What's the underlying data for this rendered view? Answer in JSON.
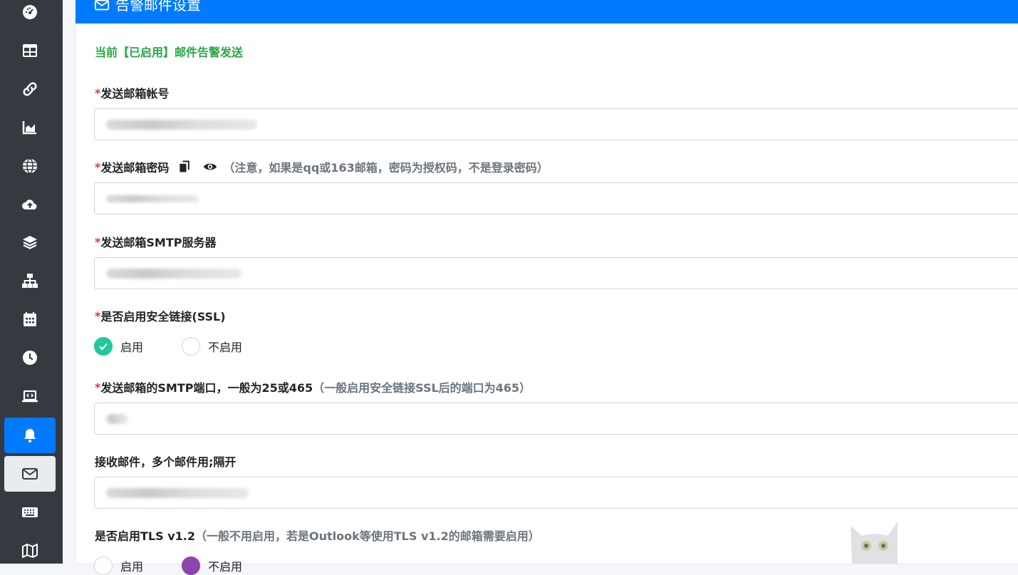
{
  "card": {
    "title": "告警邮件设置",
    "status": "当前【已启用】邮件告警发送"
  },
  "form": {
    "sender_account": {
      "required": "*",
      "label": "发送邮箱帐号"
    },
    "sender_password": {
      "required": "*",
      "label": "发送邮箱密码",
      "hint": "（注意，如果是qq或163邮箱，密码为授权码，不是登录密码）"
    },
    "smtp_server": {
      "required": "*",
      "label": "发送邮箱SMTP服务器"
    },
    "ssl": {
      "required": "*",
      "label": "是否启用安全链接(SSL)",
      "options": [
        "启用",
        "不启用"
      ],
      "selected": "启用"
    },
    "smtp_port": {
      "required": "*",
      "label": "发送邮箱的SMTP端口，一般为25或465",
      "hint": "（一般启用安全链接SSL后的端口为465）"
    },
    "recipients": {
      "label": "接收邮件，多个邮件用;隔开"
    },
    "tls": {
      "label": "是否启用TLS v1.2",
      "hint": "（一般不用启用，若是Outlook等使用TLS v1.2的邮箱需要启用）",
      "options": [
        "启用",
        "不启用"
      ],
      "selected": "不启用"
    }
  },
  "sidebar": {
    "items": [
      {
        "icon": "dashboard-icon"
      },
      {
        "icon": "table-icon"
      },
      {
        "icon": "link-icon"
      },
      {
        "icon": "chart-area-icon"
      },
      {
        "icon": "globe-icon"
      },
      {
        "icon": "cloud-upload-icon"
      },
      {
        "icon": "layers-icon"
      },
      {
        "icon": "network-icon"
      },
      {
        "icon": "calendar-icon"
      },
      {
        "icon": "clock-icon"
      },
      {
        "icon": "laptop-code-icon"
      },
      {
        "icon": "bell-icon",
        "state": "active"
      },
      {
        "icon": "envelope-icon",
        "state": "selected"
      },
      {
        "icon": "keyboard-icon"
      },
      {
        "icon": "map-icon"
      }
    ]
  },
  "colors": {
    "sidebar_bg": "#343a40",
    "header_bg": "#007bff",
    "status_green": "#28a745",
    "required_red": "#dc3545",
    "radio_green": "#20c997",
    "radio_purple": "#8e44ad"
  }
}
